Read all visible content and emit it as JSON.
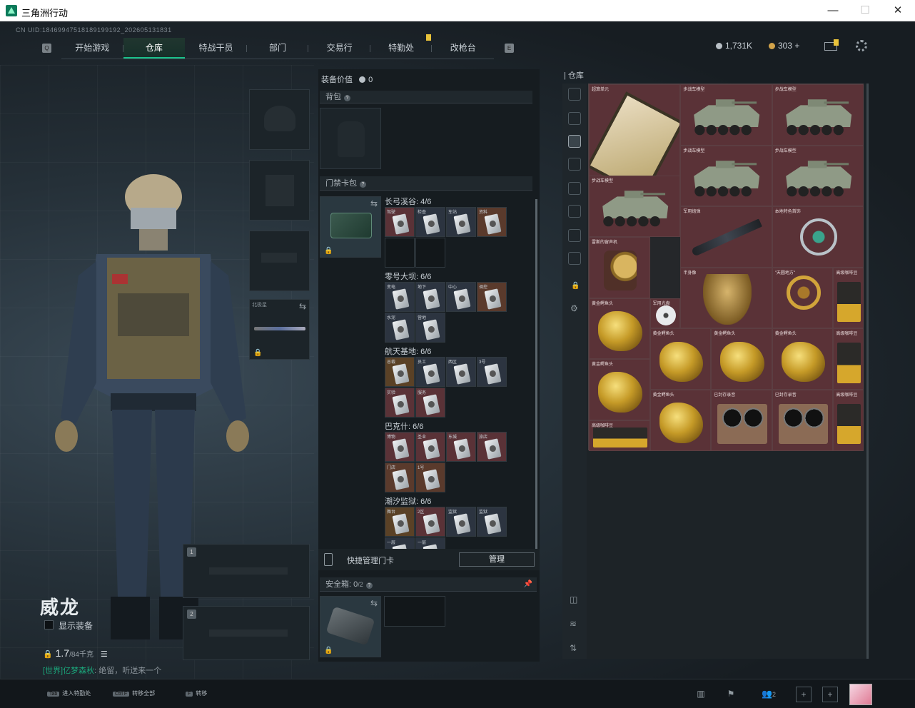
{
  "window": {
    "title": "三角洲行动",
    "minimize": "—",
    "maximize": "☐",
    "close": "✕"
  },
  "uid": "CN UID:18469947518189199192_202605131831",
  "nav": {
    "tabs": [
      "开始游戏",
      "仓库",
      "特战干员",
      "部门",
      "交易行",
      "特勤处",
      "改枪台"
    ],
    "active": "仓库",
    "left_key": "Q",
    "right_key": "E"
  },
  "currency": {
    "silver": "1,731K",
    "gold": "303",
    "plus": "+"
  },
  "character": {
    "name": "威龙",
    "show_equipment": "显示装备",
    "weight": "1.7",
    "weight_max": "/84千克"
  },
  "chat": {
    "channel": "[世界]",
    "user": "亿梦森秋",
    "message": "绝留，听送来一个"
  },
  "loadout": {
    "slot_weapon_label": "北极星",
    "primary_slot": "1",
    "secondary_slot": "2"
  },
  "equip_panel": {
    "value_label": "装备价值",
    "value": "0",
    "backpack_label": "背包",
    "keycard_label": "门禁卡包",
    "keycard_groups": [
      {
        "title": "长弓溪谷: 4/6",
        "cards": [
          "驾驶",
          "检查",
          "车站",
          "资料"
        ],
        "bgs": [
          "#5a3237",
          "#2c3440",
          "#2c3440",
          "#5a3a2c"
        ]
      },
      {
        "title": "零号大坝: 6/6",
        "cards": [
          "变电",
          "地下",
          "中心",
          "调控",
          "水泥",
          "营地"
        ],
        "bgs": [
          "#2c3440",
          "#2c3440",
          "#2c3440",
          "#5a3a2c",
          "#2c3440",
          "#2c3440"
        ]
      },
      {
        "title": "航天基地: 6/6",
        "cards": [
          "总裁",
          "员工",
          "西区",
          "3号",
          "实验",
          "服务"
        ],
        "bgs": [
          "#5a4126",
          "#2c3440",
          "#2c3440",
          "#2c3440",
          "#5a3237",
          "#5a3237"
        ]
      },
      {
        "title": "巴克什: 6/6",
        "cards": [
          "博物",
          "圣业",
          "东城",
          "旅店",
          "门店",
          "1号"
        ],
        "bgs": [
          "#5a3237",
          "#5a3237",
          "#5a3237",
          "#5a3237",
          "#5a3a2c",
          "#5a3a2c"
        ]
      },
      {
        "title": "潮汐监狱: 6/6",
        "cards": [
          "舞台",
          "2区",
          "监狱",
          "监狱",
          "一层",
          "一层"
        ],
        "bgs": [
          "#5a4126",
          "#5a3237",
          "#2c3440",
          "#2c3440",
          "#2c3440",
          "#2c3440"
        ]
      }
    ],
    "quick_manage": "快捷管理门卡",
    "manage_button": "管理",
    "safebox_label": "安全箱:",
    "safebox_value": "0",
    "safebox_cap": "/2"
  },
  "stash": {
    "title": "仓库",
    "items": [
      {
        "name": "超算单元",
        "kind": "gpu"
      },
      {
        "name": "步战车模型",
        "kind": "apc"
      },
      {
        "name": "步战车模型",
        "kind": "apc"
      },
      {
        "name": "步战车模型",
        "kind": "apc"
      },
      {
        "name": "步战车模型",
        "kind": "apc"
      },
      {
        "name": "步战车模型",
        "kind": "apc"
      },
      {
        "name": "军用炮弹",
        "kind": "shell"
      },
      {
        "name": "本地特色首饰",
        "kind": "jewel"
      },
      {
        "name": "雷斯的留声机",
        "kind": "gramophone"
      },
      {
        "name": "半身像",
        "kind": "bust"
      },
      {
        "name": "\"天圆地方\"",
        "kind": "globe"
      },
      {
        "name": "高级咖啡豆",
        "kind": "coffee"
      },
      {
        "name": "黄金鳄鱼头",
        "kind": "gold"
      },
      {
        "name": "军用光盘",
        "kind": "disc"
      },
      {
        "name": "黄金鳄鱼头",
        "kind": "gold"
      },
      {
        "name": "黄金鳄鱼头",
        "kind": "gold"
      },
      {
        "name": "黄金鳄鱼头",
        "kind": "gold"
      },
      {
        "name": "高级咖啡豆",
        "kind": "coffee"
      },
      {
        "name": "黄金鳄鱼头",
        "kind": "gold"
      },
      {
        "name": "黄金鳄鱼头",
        "kind": "gold"
      },
      {
        "name": "已封存录音",
        "kind": "reel"
      },
      {
        "name": "已封存录音",
        "kind": "reel"
      },
      {
        "name": "高级咖啡豆",
        "kind": "coffee"
      },
      {
        "name": "高级咖啡豆",
        "kind": "coffee"
      }
    ]
  },
  "hotkeys": [
    {
      "key": "Tab",
      "label": "进入特勤处"
    },
    {
      "key": "Ctrl F",
      "label": "转移全部"
    },
    {
      "key": "F",
      "label": "转移"
    }
  ],
  "bottom_right": {
    "squad_count": "2"
  },
  "icons": {
    "settings": "gear-icon",
    "mail": "mail-icon",
    "lock": "lock-icon",
    "swap": "swap-icon"
  },
  "colors": {
    "accent": "#19c28a",
    "stash_bg": "#5a3237",
    "notif": "#e8c23a"
  }
}
